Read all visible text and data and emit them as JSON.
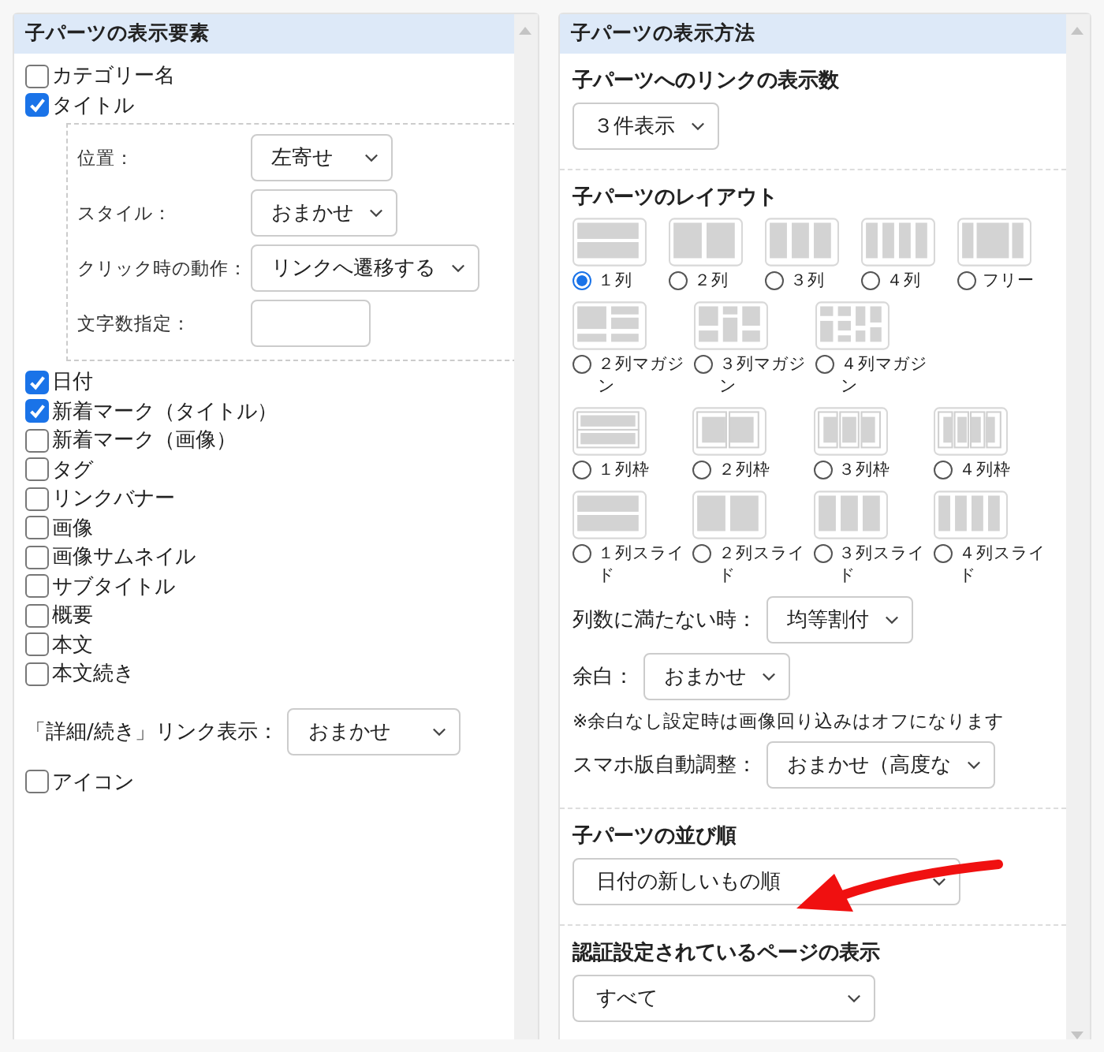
{
  "left_panel": {
    "title": "子パーツの表示要素",
    "items": [
      {
        "kind": "checkbox",
        "label": "カテゴリー名",
        "checked": false
      },
      {
        "kind": "checkbox",
        "label": "タイトル",
        "checked": true,
        "settings": [
          {
            "kind": "select",
            "label": "位置：",
            "value": "左寄せ"
          },
          {
            "kind": "select",
            "label": "スタイル：",
            "value": "おまかせ"
          },
          {
            "kind": "select",
            "label": "クリック時の動作：",
            "value": "リンクへ遷移する"
          },
          {
            "kind": "input",
            "label": "文字数指定："
          }
        ]
      },
      {
        "kind": "checkbox",
        "label": "日付",
        "checked": true
      },
      {
        "kind": "checkbox",
        "label": "新着マーク（タイトル）",
        "checked": true
      },
      {
        "kind": "checkbox",
        "label": "新着マーク（画像）",
        "checked": false
      },
      {
        "kind": "checkbox",
        "label": "タグ",
        "checked": false
      },
      {
        "kind": "checkbox",
        "label": "リンクバナー",
        "checked": false
      },
      {
        "kind": "checkbox",
        "label": "画像",
        "checked": false
      },
      {
        "kind": "checkbox",
        "label": "画像サムネイル",
        "checked": false
      },
      {
        "kind": "checkbox",
        "label": "サブタイトル",
        "checked": false
      },
      {
        "kind": "checkbox",
        "label": "概要",
        "checked": false
      },
      {
        "kind": "checkbox",
        "label": "本文",
        "checked": false
      },
      {
        "kind": "checkbox",
        "label": "本文続き",
        "checked": false
      },
      {
        "kind": "select",
        "label": "「詳細/続き」リンク表示：",
        "value": "おまかせ"
      },
      {
        "kind": "checkbox",
        "label": "アイコン",
        "checked": false
      }
    ]
  },
  "right_panel": {
    "title": "子パーツの表示方法",
    "sections": [
      {
        "heading": "子パーツへのリンクの表示数",
        "items": [
          {
            "kind": "select",
            "value": "３件表示"
          }
        ]
      },
      {
        "heading": "子パーツのレイアウト",
        "items": [
          {
            "kind": "layout",
            "options": [
              {
                "kind": "rows",
                "label": "１列",
                "selected": true
              },
              {
                "kind": "cols2",
                "label": "２列",
                "selected": false
              },
              {
                "kind": "cols3",
                "label": "３列",
                "selected": false
              },
              {
                "kind": "cols4",
                "label": "４列",
                "selected": false
              },
              {
                "kind": "free",
                "label": "フリー",
                "selected": false
              }
            ]
          },
          {
            "kind": "layout",
            "options": [
              {
                "kind": "mag2",
                "label": "２列マガジン",
                "selected": false
              },
              {
                "kind": "mag3",
                "label": "３列マガジン",
                "selected": false
              },
              {
                "kind": "mag4",
                "label": "４列マガジン",
                "selected": false
              }
            ]
          },
          {
            "kind": "layout",
            "options": [
              {
                "kind": "frame1",
                "label": "１列枠",
                "selected": false
              },
              {
                "kind": "frame2",
                "label": "２列枠",
                "selected": false
              },
              {
                "kind": "frame3",
                "label": "３列枠",
                "selected": false
              },
              {
                "kind": "frame4",
                "label": "４列枠",
                "selected": false
              }
            ]
          },
          {
            "kind": "layout",
            "options": [
              {
                "kind": "slide1",
                "label": "１列スライド",
                "selected": false
              },
              {
                "kind": "slide2",
                "label": "２列スライド",
                "selected": false
              },
              {
                "kind": "slide3",
                "label": "３列スライド",
                "selected": false
              },
              {
                "kind": "slide4",
                "label": "４列スライド",
                "selected": false
              }
            ]
          },
          {
            "kind": "select",
            "label": "列数に満たない時：",
            "value": "均等割付"
          },
          {
            "kind": "select",
            "label": "余白：",
            "value": "おまかせ"
          },
          {
            "kind": "note",
            "text": "※余白なし設定時は画像回り込みはオフになります"
          },
          {
            "kind": "select",
            "label": "スマホ版自動調整：",
            "value": "おまかせ（高度な"
          }
        ]
      },
      {
        "heading": "子パーツの並び順",
        "items": [
          {
            "kind": "select",
            "value": "日付の新しいもの順"
          }
        ]
      },
      {
        "heading": "認証設定されているページの表示",
        "items": [
          {
            "kind": "select",
            "value": "すべて"
          }
        ]
      }
    ]
  }
}
